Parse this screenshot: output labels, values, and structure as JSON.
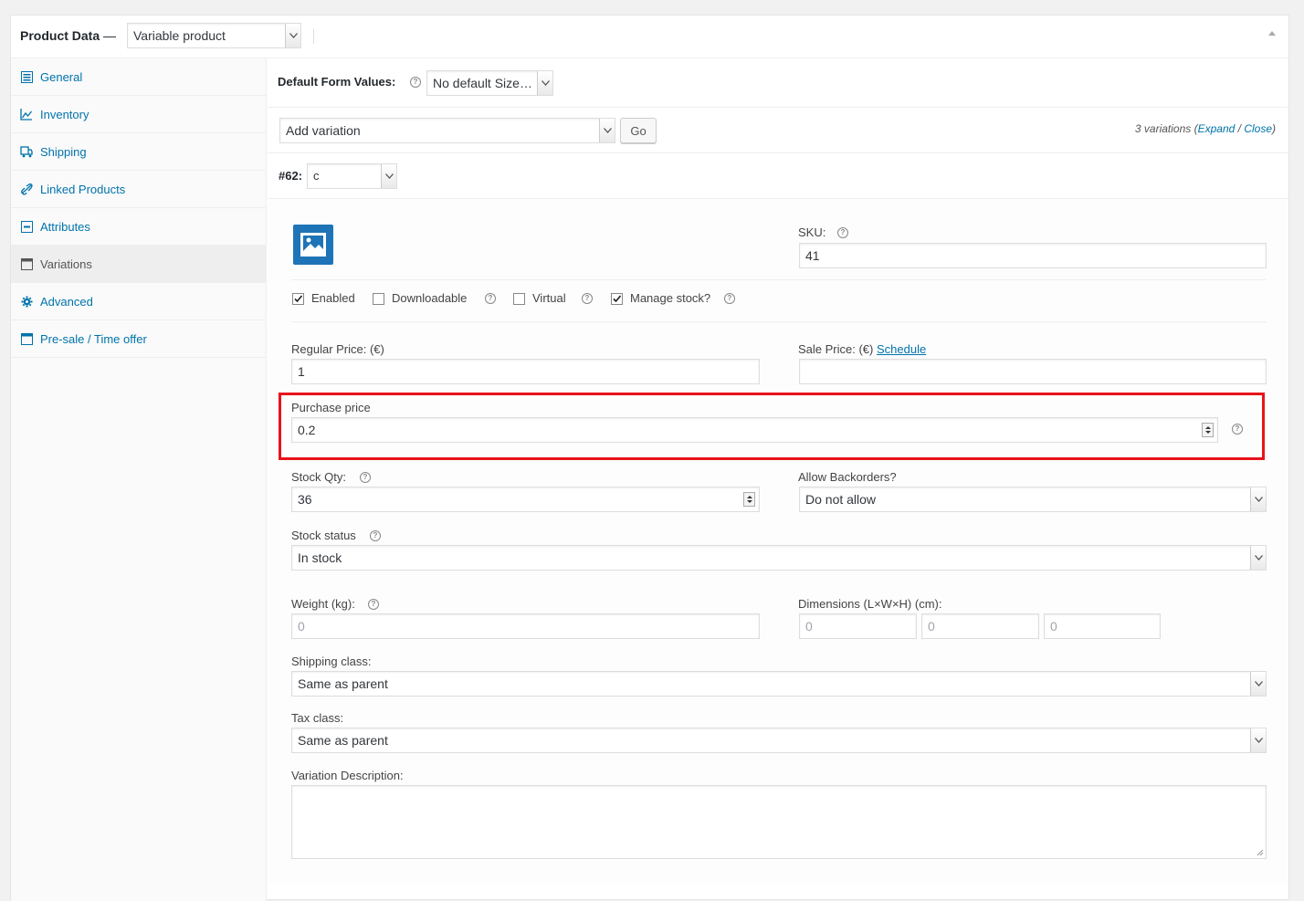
{
  "header": {
    "title": "Product Data",
    "dash": " —",
    "product_type": "Variable product"
  },
  "sidebar": {
    "items": [
      {
        "label": "General",
        "icon": "general-icon"
      },
      {
        "label": "Inventory",
        "icon": "inventory-icon"
      },
      {
        "label": "Shipping",
        "icon": "shipping-icon"
      },
      {
        "label": "Linked Products",
        "icon": "link-icon"
      },
      {
        "label": "Attributes",
        "icon": "attributes-icon"
      },
      {
        "label": "Variations",
        "icon": "variations-icon",
        "active": true
      },
      {
        "label": "Advanced",
        "icon": "gear-icon"
      },
      {
        "label": "Pre-sale / Time offer",
        "icon": "window-icon"
      }
    ]
  },
  "defaults": {
    "label": "Default Form Values:",
    "select_value": "No default Size…"
  },
  "add_variation": {
    "select_value": "Add variation",
    "go_label": "Go",
    "count_text": "3 variations (",
    "expand": "Expand",
    "sep": " / ",
    "close": "Close",
    "end": ")"
  },
  "variation": {
    "id_label": "#62:",
    "attribute_value": "c",
    "sku_label": "SKU:",
    "sku_value": "41",
    "options": {
      "enabled": "Enabled",
      "downloadable": "Downloadable",
      "virtual": "Virtual",
      "manage_stock": "Manage stock?"
    },
    "regular_price_label": "Regular Price: (€)",
    "regular_price_value": "1",
    "sale_price_label": "Sale Price: (€) ",
    "schedule_link": "Schedule",
    "sale_price_value": "",
    "purchase_price_label": "Purchase price",
    "purchase_price_value": "0.2",
    "stock_qty_label": "Stock Qty:",
    "stock_qty_value": "36",
    "backorders_label": "Allow Backorders?",
    "backorders_value": "Do not allow",
    "stock_status_label": "Stock status",
    "stock_status_value": "In stock",
    "weight_label": "Weight (kg):",
    "weight_placeholder": "0",
    "dimensions_label": "Dimensions (L×W×H) (cm):",
    "dim_placeholder": "0",
    "shipping_class_label": "Shipping class:",
    "shipping_class_value": "Same as parent",
    "tax_class_label": "Tax class:",
    "tax_class_value": "Same as parent",
    "description_label": "Variation Description:",
    "description_value": ""
  },
  "colors": {
    "accent": "#0073aa",
    "highlight": "#e8131b",
    "image_placeholder": "#1e74b6"
  }
}
